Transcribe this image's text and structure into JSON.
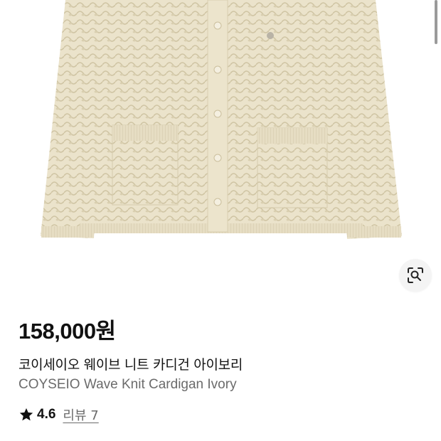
{
  "product": {
    "image_alt": "knit cardigan product photo",
    "price": "158,000원",
    "name_ko": "코이세이오 웨이브 니트 카디건 아이보리",
    "name_en": "COYSEIO Wave Knit Cardigan Ivory",
    "rating": "4.6",
    "reviews_label": "리뷰 7"
  },
  "icons": {
    "lens": "image-search-icon",
    "star": "star-icon"
  },
  "colors": {
    "cardigan": "#e8dfc6",
    "text": "#111111",
    "muted": "#6b6b6b"
  }
}
